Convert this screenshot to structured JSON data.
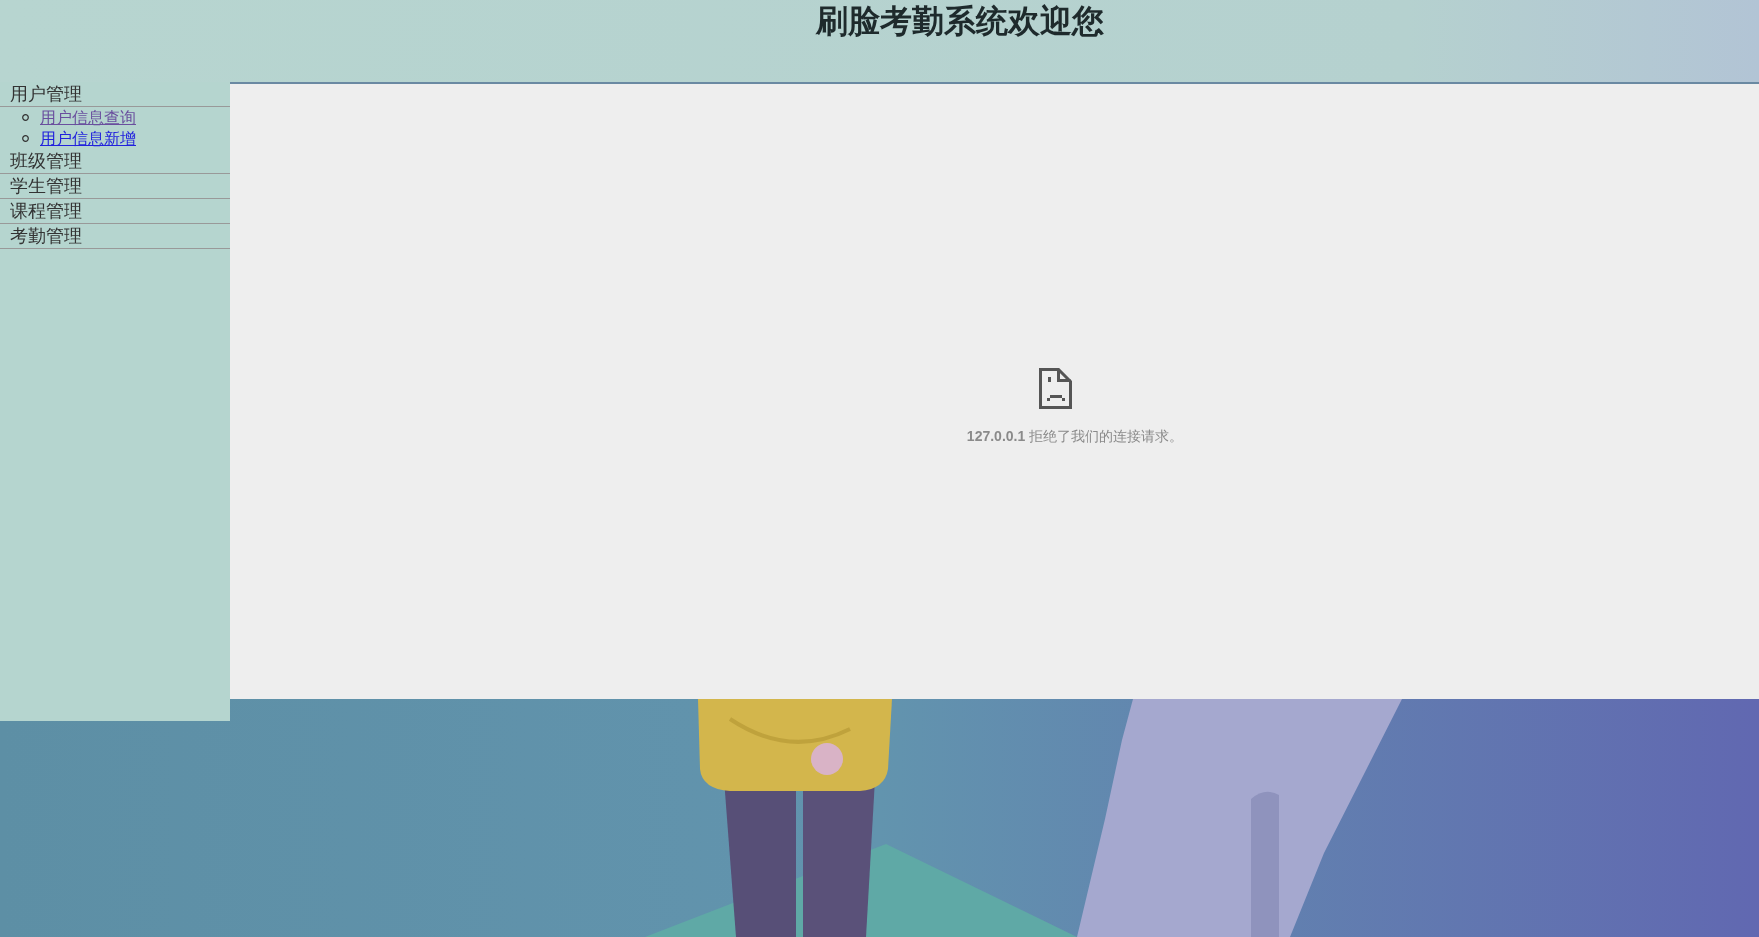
{
  "header": {
    "title": "刷脸考勤系统欢迎您"
  },
  "sidebar": {
    "groups": [
      {
        "label": "用户管理",
        "links": [
          {
            "label": "用户信息查询",
            "visited": true
          },
          {
            "label": "用户信息新增",
            "visited": false
          }
        ]
      },
      {
        "label": "班级管理"
      },
      {
        "label": "学生管理"
      },
      {
        "label": "课程管理"
      },
      {
        "label": "考勤管理"
      }
    ]
  },
  "main": {
    "error_message": "**127.0.0.1** 拒绝了我们的连接请求。"
  }
}
